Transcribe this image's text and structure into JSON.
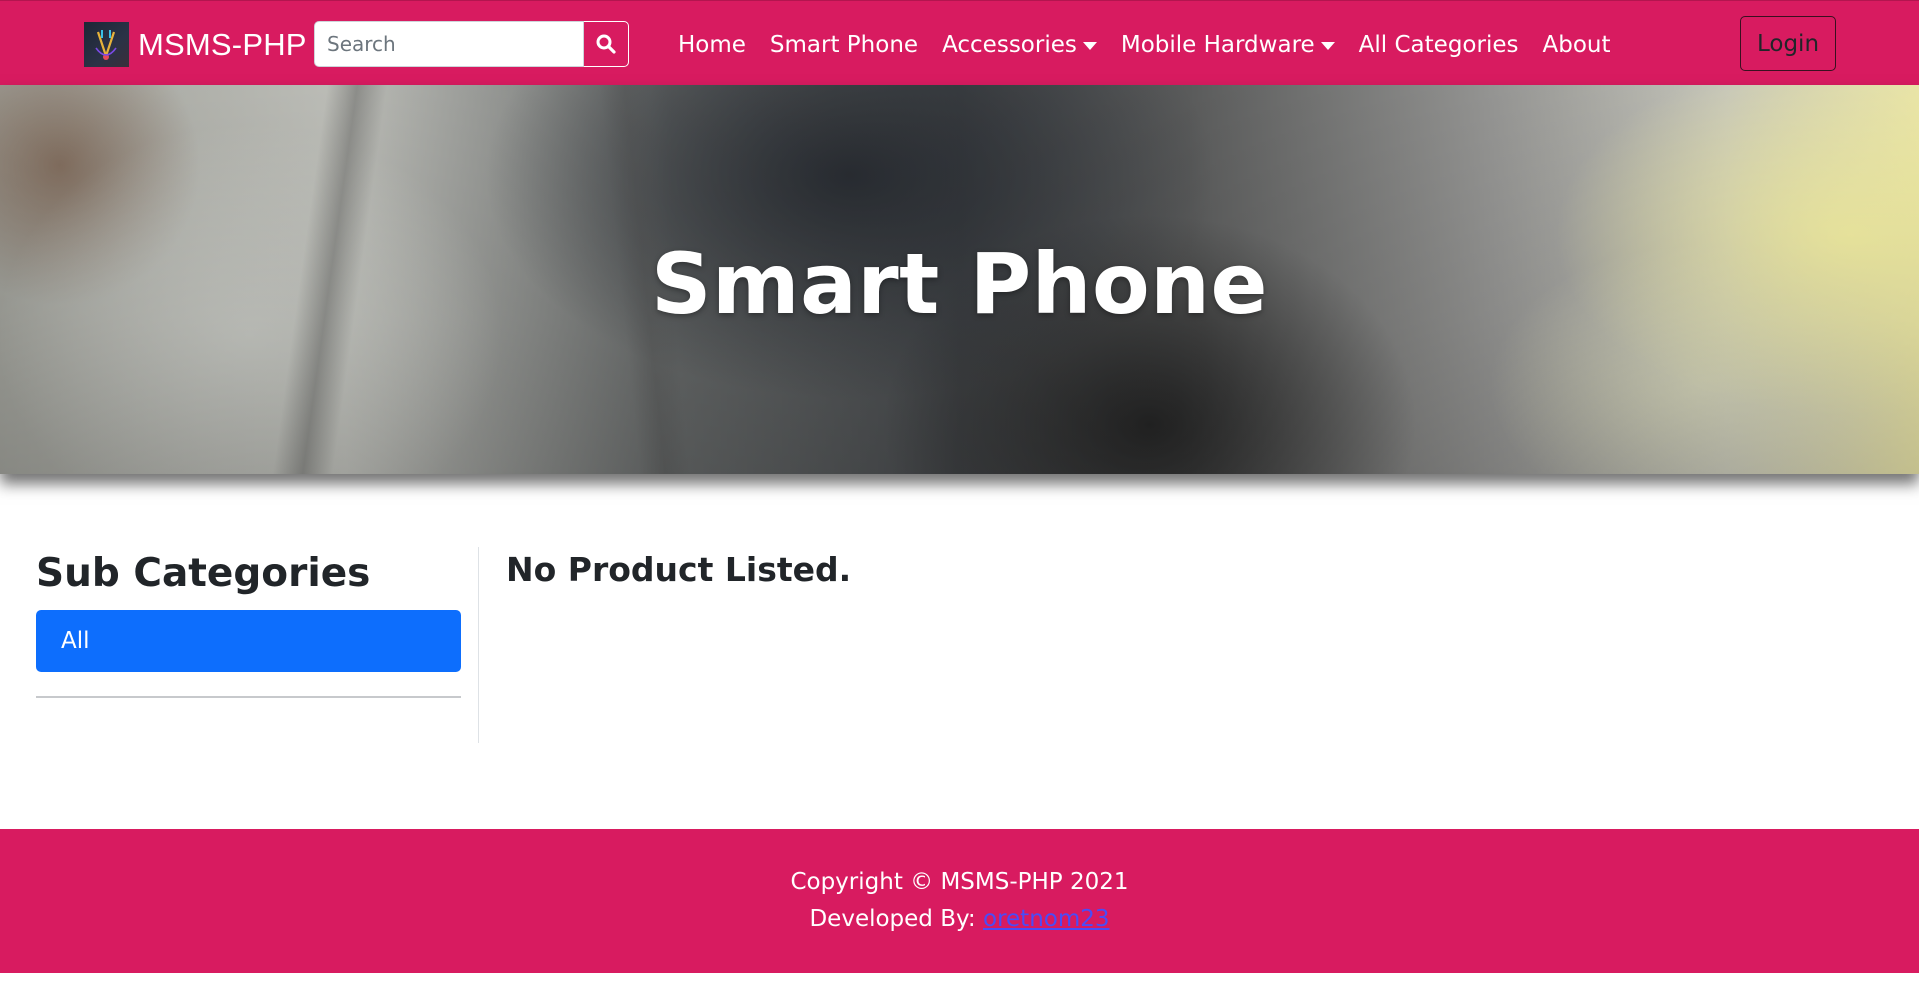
{
  "navbar": {
    "brand": "MSMS-PHP",
    "search": {
      "placeholder": "Search",
      "value": ""
    },
    "links": [
      {
        "label": "Home",
        "dropdown": false
      },
      {
        "label": "Smart Phone",
        "dropdown": false
      },
      {
        "label": "Accessories",
        "dropdown": true
      },
      {
        "label": "Mobile Hardware",
        "dropdown": true
      },
      {
        "label": "All Categories",
        "dropdown": false
      },
      {
        "label": "About",
        "dropdown": false
      }
    ],
    "login_label": "Login",
    "bg_color": "#d81b60"
  },
  "hero": {
    "title": "Smart Phone"
  },
  "sidebar": {
    "title": "Sub Categories",
    "items": [
      {
        "label": "All",
        "active": true
      }
    ],
    "active_color": "#0d6efd"
  },
  "main": {
    "empty_message": "No Product Listed."
  },
  "footer": {
    "copyright": "Copyright © MSMS-PHP 2021",
    "developed_by_label": "Developed By:",
    "developer": "oretnom23",
    "link_color": "#4a4cf7"
  },
  "icons": {
    "brand": "brand-logo-icon",
    "search": "search-icon",
    "dropdown": "caret-down-icon"
  }
}
